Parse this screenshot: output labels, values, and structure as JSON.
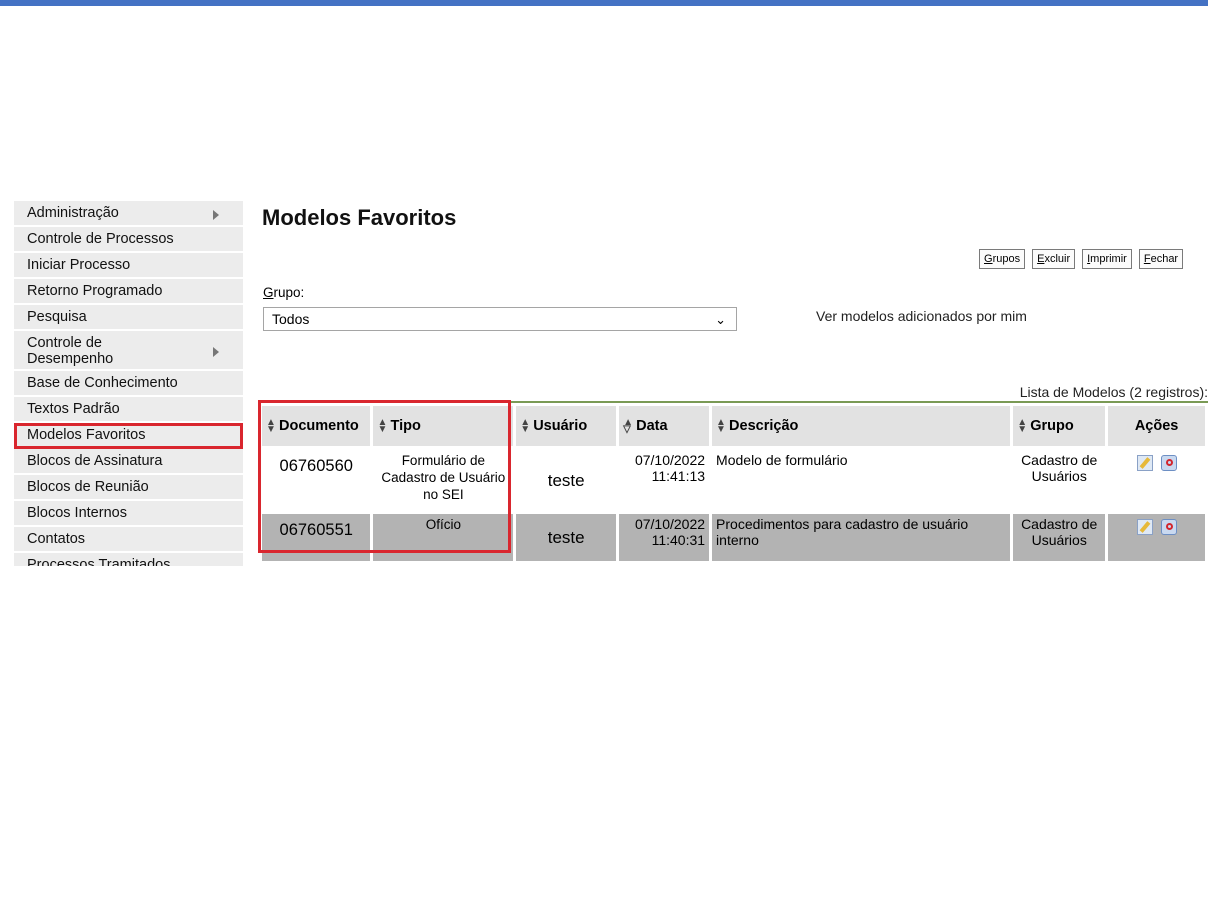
{
  "menu": {
    "items": [
      {
        "label": "Administração",
        "submenu": true
      },
      {
        "label": "Controle de Processos"
      },
      {
        "label": "Iniciar Processo"
      },
      {
        "label": "Retorno Programado"
      },
      {
        "label": "Pesquisa"
      },
      {
        "label": "Controle de Desempenho",
        "submenu": true
      },
      {
        "label": "Base de Conhecimento"
      },
      {
        "label": "Textos Padrão"
      },
      {
        "label": "Modelos Favoritos",
        "selected": true
      },
      {
        "label": "Blocos de Assinatura"
      },
      {
        "label": "Blocos de Reunião"
      },
      {
        "label": "Blocos Internos"
      },
      {
        "label": "Contatos"
      },
      {
        "label": "Processos Tramitados"
      }
    ]
  },
  "page": {
    "title": "Modelos Favoritos",
    "buttons": {
      "grupos": {
        "accesskey": "G",
        "rest": "rupos"
      },
      "excluir": {
        "accesskey": "E",
        "rest": "xcluir"
      },
      "imprimir": {
        "accesskey": "I",
        "rest": "mprimir"
      },
      "fechar": {
        "accesskey": "F",
        "rest": "echar"
      }
    },
    "grupo_label": {
      "accesskey": "G",
      "rest": "rupo:"
    },
    "grupo_select_value": "Todos",
    "ver_link": "Ver modelos adicionados por mim"
  },
  "table": {
    "caption": "Lista de Modelos (2 registros):",
    "headers": {
      "documento": "Documento",
      "tipo": "Tipo",
      "usuario": "Usuário",
      "data": "Data",
      "descricao": "Descrição",
      "grupo": "Grupo",
      "acoes": "Ações"
    },
    "rows": [
      {
        "documento": "06760560",
        "tipo": "Formulário de Cadastro de Usuário no SEI",
        "usuario": "teste",
        "data": "07/10/2022",
        "hora": "11:41:13",
        "descricao": "Modelo de formulário",
        "grupo": "Cadastro de Usuários"
      },
      {
        "documento": "06760551",
        "tipo": "Ofício",
        "usuario": "teste",
        "data": "07/10/2022",
        "hora": "11:40:31",
        "descricao": "Procedimentos para cadastro de usuário interno",
        "grupo": "Cadastro de Usuários"
      }
    ]
  },
  "colors": {
    "accent_bar": "#4472c4",
    "highlight": "#d9262e",
    "selected_row": "#b3b3b3"
  }
}
